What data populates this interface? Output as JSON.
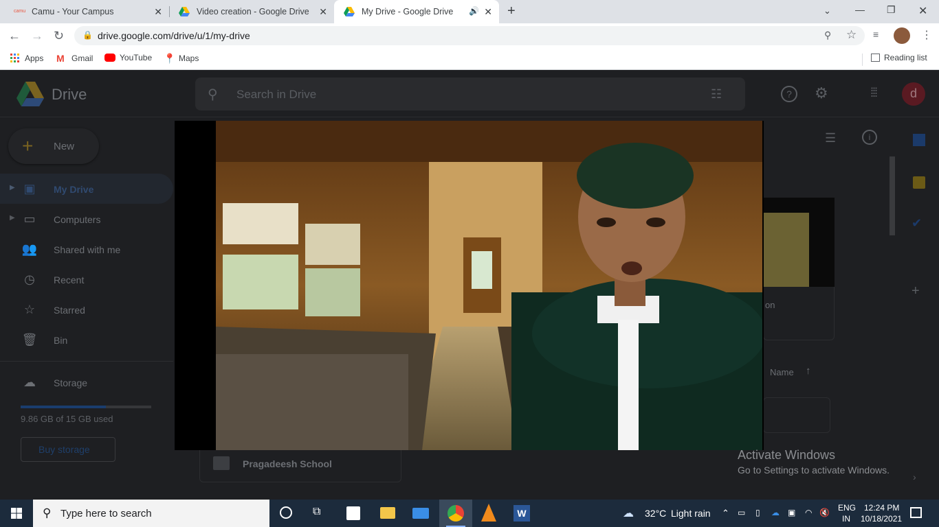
{
  "browser": {
    "tabs": [
      {
        "label": "Camu - Your Campus",
        "active": false
      },
      {
        "label": "Video creation - Google Drive",
        "active": false
      },
      {
        "label": "My Drive - Google Drive",
        "active": true
      }
    ],
    "url": "drive.google.com/drive/u/1/my-drive",
    "bookmarks": [
      "Apps",
      "Gmail",
      "YouTube",
      "Maps"
    ],
    "reading_list": "Reading list"
  },
  "drive": {
    "app_name": "Drive",
    "search_placeholder": "Search in Drive",
    "new_label": "New",
    "avatar_letter": "d",
    "nav": [
      "My Drive",
      "Computers",
      "Shared with me",
      "Recent",
      "Starred",
      "Bin"
    ],
    "storage_label": "Storage",
    "storage_used": "9.86 GB of 15 GB used",
    "storage_fraction": 0.657,
    "buy_storage": "Buy storage",
    "folder_name": "Pragadeesh School",
    "sort_label": "Name",
    "partial_file_label": "on"
  },
  "activation": {
    "title": "Activate Windows",
    "subtitle": "Go to Settings to activate Windows."
  },
  "taskbar": {
    "search_placeholder": "Type here to search",
    "weather_temp": "32°C",
    "weather_desc": "Light rain",
    "lang_top": "ENG",
    "lang_bottom": "IN",
    "time": "12:24 PM",
    "date": "10/18/2021"
  }
}
